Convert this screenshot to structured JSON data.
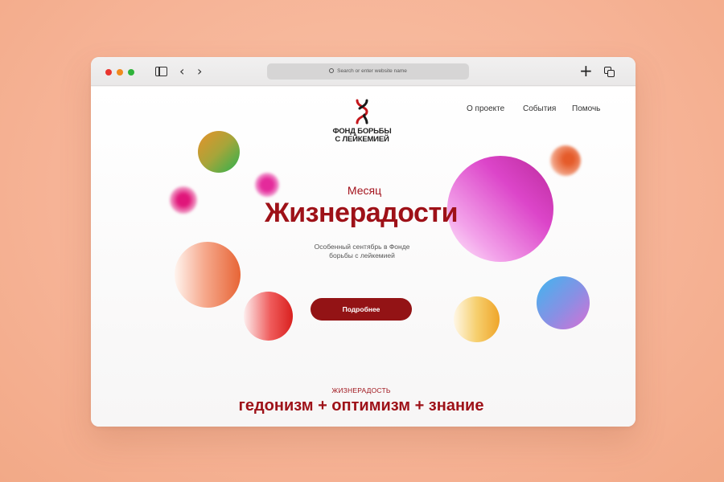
{
  "browser": {
    "url_placeholder": "Search or enter website name",
    "icons": [
      "close-dot",
      "minimize-dot",
      "maximize-dot",
      "sidebar-icon",
      "chevron-left-icon",
      "chevron-right-icon",
      "search-icon",
      "plus-icon",
      "tabs-icon"
    ],
    "colors": {
      "close": "#e9352f",
      "minimize": "#f08a1e",
      "maximize": "#2fb33b"
    }
  },
  "logo": {
    "line1": "ФОНД БОРЬБЫ",
    "line2": "С ЛЕЙКЕМИЕЙ",
    "icon": "dna-ribbon-icon"
  },
  "nav": {
    "items": [
      "О проекте",
      "События",
      "Помочь"
    ]
  },
  "hero": {
    "small_title": "Месяц",
    "headline": "Жизнерадости",
    "subtitle": "Особенный сентябрь в Фонде борьбы с лейкемией",
    "cta_label": "Подробнее"
  },
  "section": {
    "kicker": "ЖИЗНЕРАДОСТЬ",
    "formula": "гедонизм + оптимизм + знание"
  },
  "colors": {
    "brand": "#9e1118",
    "button": "#931315",
    "background": "#f6b396"
  }
}
